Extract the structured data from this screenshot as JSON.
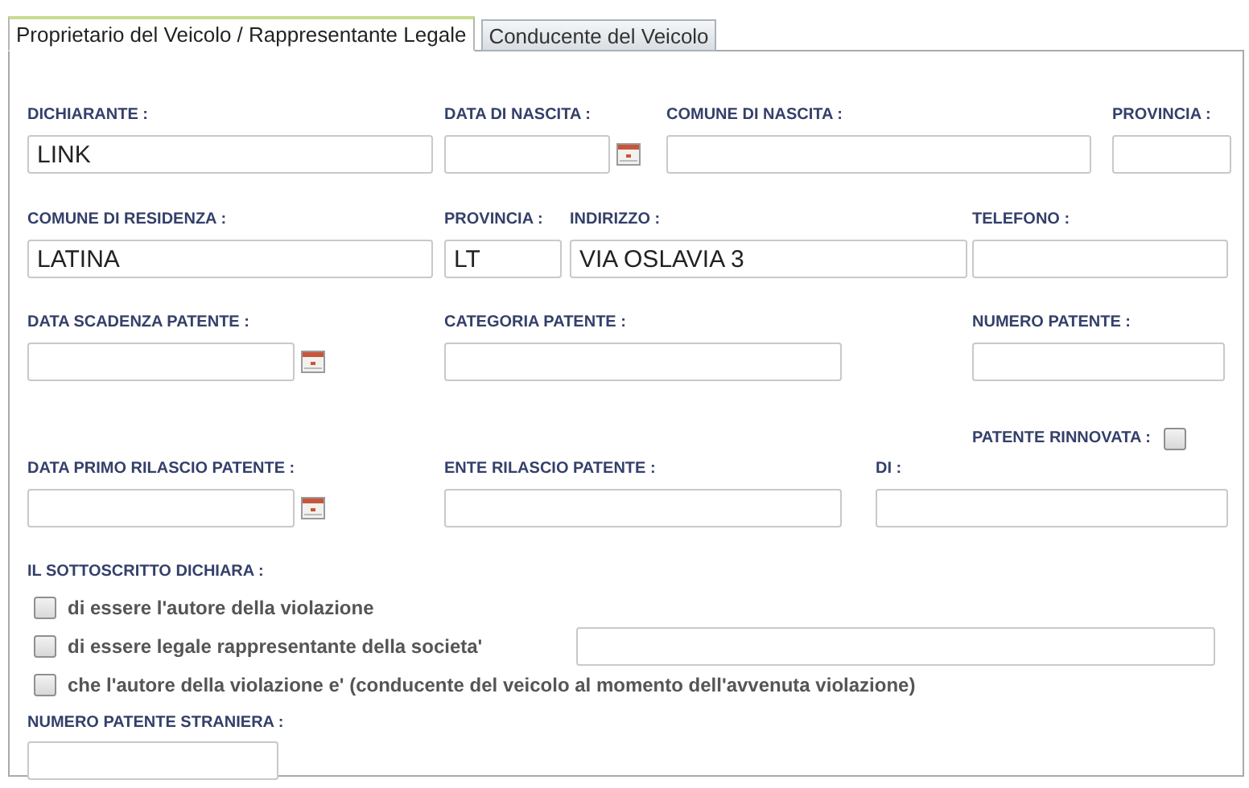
{
  "tabs": [
    {
      "label": "Proprietario del Veicolo / Rappresentante Legale",
      "selected": true
    },
    {
      "label": "Conducente del Veicolo",
      "selected": false
    }
  ],
  "rows": [
    [
      {
        "label": "DICHIARANTE :",
        "kind": "text",
        "value": "LINK"
      },
      {
        "label": "DATA DI NASCITA :",
        "kind": "date"
      },
      {
        "label": "COMUNE DI NASCITA :",
        "kind": "text"
      },
      {
        "label": "PROVINCIA :",
        "kind": "text"
      }
    ],
    [
      {
        "label": "COMUNE DI RESIDENZA :",
        "kind": "text",
        "value": "LATINA"
      },
      {
        "label": "PROVINCIA :",
        "kind": "text",
        "value": "LT"
      },
      {
        "label": "INDIRIZZO :",
        "kind": "text",
        "value": "VIA OSLAVIA 3"
      },
      {
        "label": "TELEFONO :",
        "kind": "text"
      }
    ],
    [
      {
        "label": "DATA SCADENZA PATENTE :",
        "kind": "date"
      },
      {
        "label": "CATEGORIA PATENTE :",
        "kind": "text"
      },
      {
        "label": "NUMERO PATENTE :",
        "kind": "text"
      }
    ]
  ],
  "patente_rinnovata": {
    "label": "PATENTE RINNOVATA :",
    "checked": false
  },
  "rilascio_row": [
    {
      "label": "DATA PRIMO RILASCIO PATENTE :",
      "kind": "date"
    },
    {
      "label": "ENTE RILASCIO PATENTE :",
      "kind": "text"
    },
    {
      "label": "DI :",
      "kind": "text"
    }
  ],
  "dichiarazione": {
    "label": "IL SOTTOSCRITTO DICHIARA :",
    "options": [
      {
        "label": "di essere l'autore della violazione",
        "checked": false,
        "kind": "plain"
      },
      {
        "label": "di essere legale rappresentante della societa'",
        "checked": false,
        "kind": "with_field"
      },
      {
        "label": "che l'autore della violazione e' (conducente del veicolo al momento dell'avvenuta violazione)",
        "checked": false,
        "kind": "plain"
      }
    ]
  },
  "numero_patente_straniera": {
    "label": "NUMERO PATENTE STRANIERA :"
  }
}
